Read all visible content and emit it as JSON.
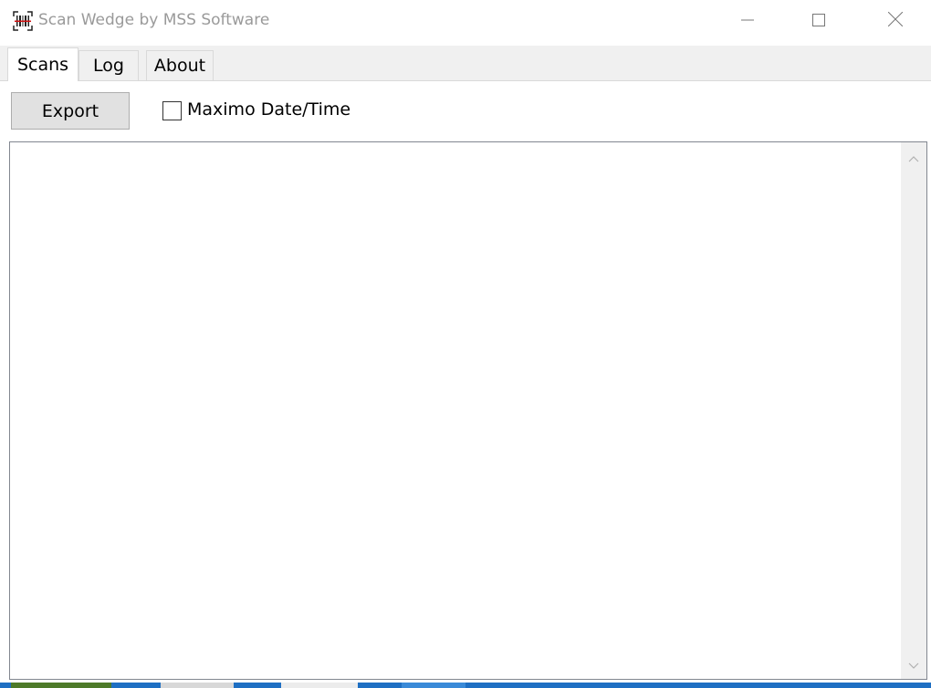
{
  "window": {
    "title": "Scan Wedge by MSS Software",
    "app_icon": "barcode-icon",
    "controls": {
      "minimize_icon": "minimize-icon",
      "maximize_icon": "maximize-icon",
      "close_icon": "close-icon"
    }
  },
  "tabs": [
    {
      "label": "Scans",
      "active": true
    },
    {
      "label": "Log",
      "active": false
    },
    {
      "label": "About",
      "active": false
    }
  ],
  "toolbar": {
    "export_label": "Export",
    "maximo_checkbox_label": "Maximo Date/Time",
    "maximo_checked": false
  },
  "scan_list": {
    "items": [],
    "scroll_up_icon": "chevron-up-icon",
    "scroll_down_icon": "chevron-down-icon"
  },
  "colors": {
    "tab_strip_bg": "#f0f0f0",
    "button_bg": "#e1e1e1",
    "title_text": "#9a9a9a",
    "taskbar": "#1e6fc3"
  }
}
